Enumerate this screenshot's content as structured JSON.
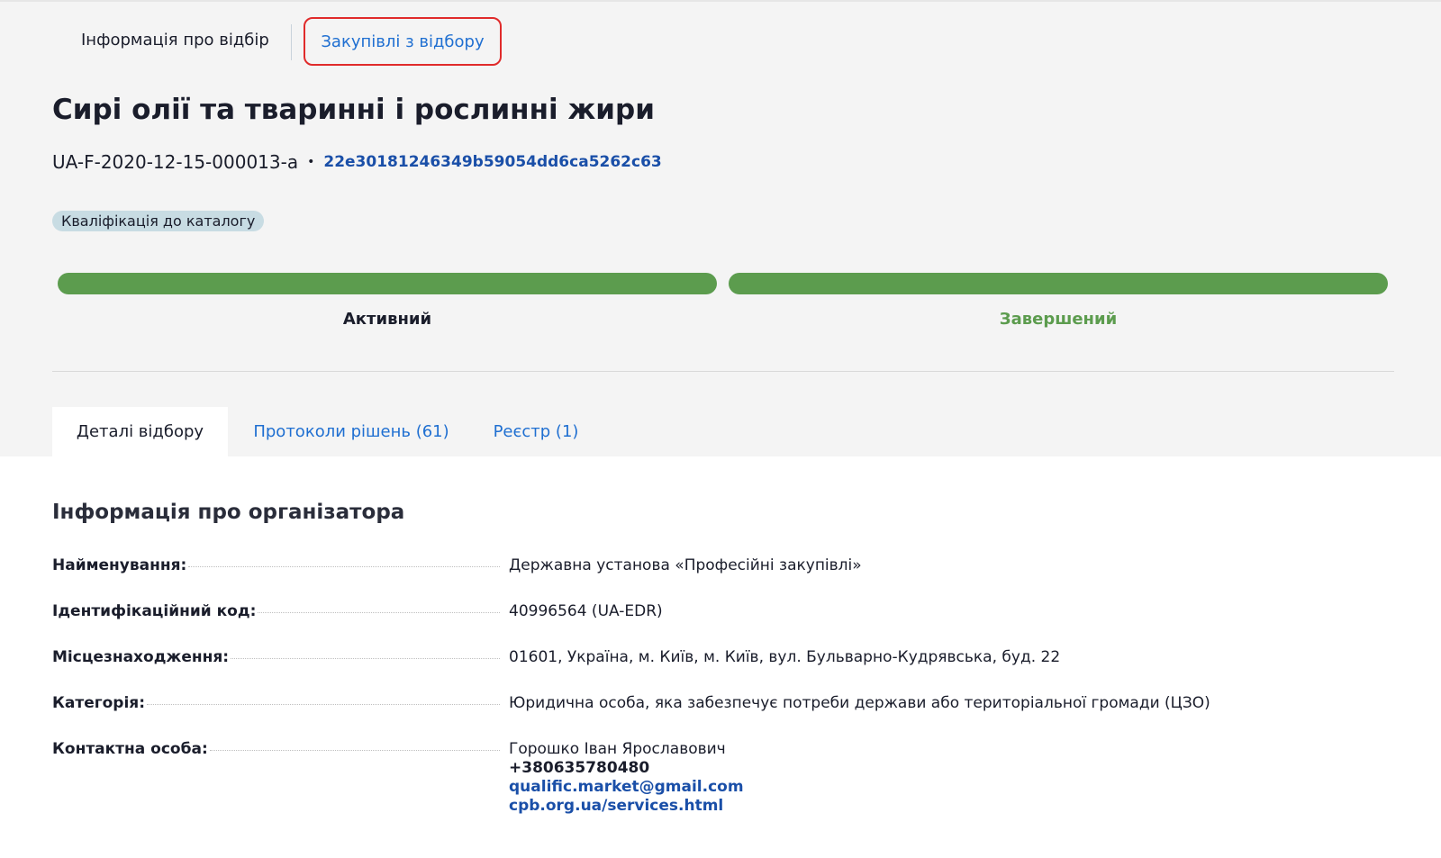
{
  "nav": {
    "tab_info": "Інформація про відбір",
    "tab_purchases": "Закупівлі з відбору"
  },
  "title": "Сирі олії та тваринні і рослинні жири",
  "ids": {
    "code": "UA-F-2020-12-15-000013-a",
    "separator": "•",
    "hash": "22e30181246349b59054dd6ca5262c63"
  },
  "badge": "Кваліфікація до каталогу",
  "stages": [
    {
      "label": "Активний",
      "progress": 1.0
    },
    {
      "label": "Завершений",
      "progress": 1.0
    }
  ],
  "tabs": [
    {
      "label": "Деталі відбору",
      "active": true
    },
    {
      "label": "Протоколи рішень (61)",
      "active": false
    },
    {
      "label": "Реєстр (1)",
      "active": false
    }
  ],
  "organizer": {
    "section_title": "Інформація про організатора",
    "rows": [
      {
        "label": "Найменування:",
        "value": "Державна установа «Професійні закупівлі»"
      },
      {
        "label": "Ідентифікаційний код:",
        "value": "40996564 (UA-EDR)"
      },
      {
        "label": "Місцезнаходження:",
        "value": "01601, Україна, м. Київ, м. Київ, вул. Бульварно-Кудрявська, буд. 22"
      },
      {
        "label": "Категорія:",
        "value": "Юридична особа, яка забезпечує потреби держави або територіальної громади (ЦЗО)"
      }
    ],
    "contact": {
      "label": "Контактна особа:",
      "name": "Горошко Іван Ярославович",
      "phone": "+380635780480",
      "email": "qualific.market@gmail.com",
      "website": "cpb.org.ua/services.html"
    }
  },
  "colors": {
    "accent_link": "#1f6fd1",
    "dark_link": "#1a4fa8",
    "progress_green": "#5c9c4e",
    "highlight_red": "#e02b2b",
    "badge_bg": "#c8dce3"
  }
}
